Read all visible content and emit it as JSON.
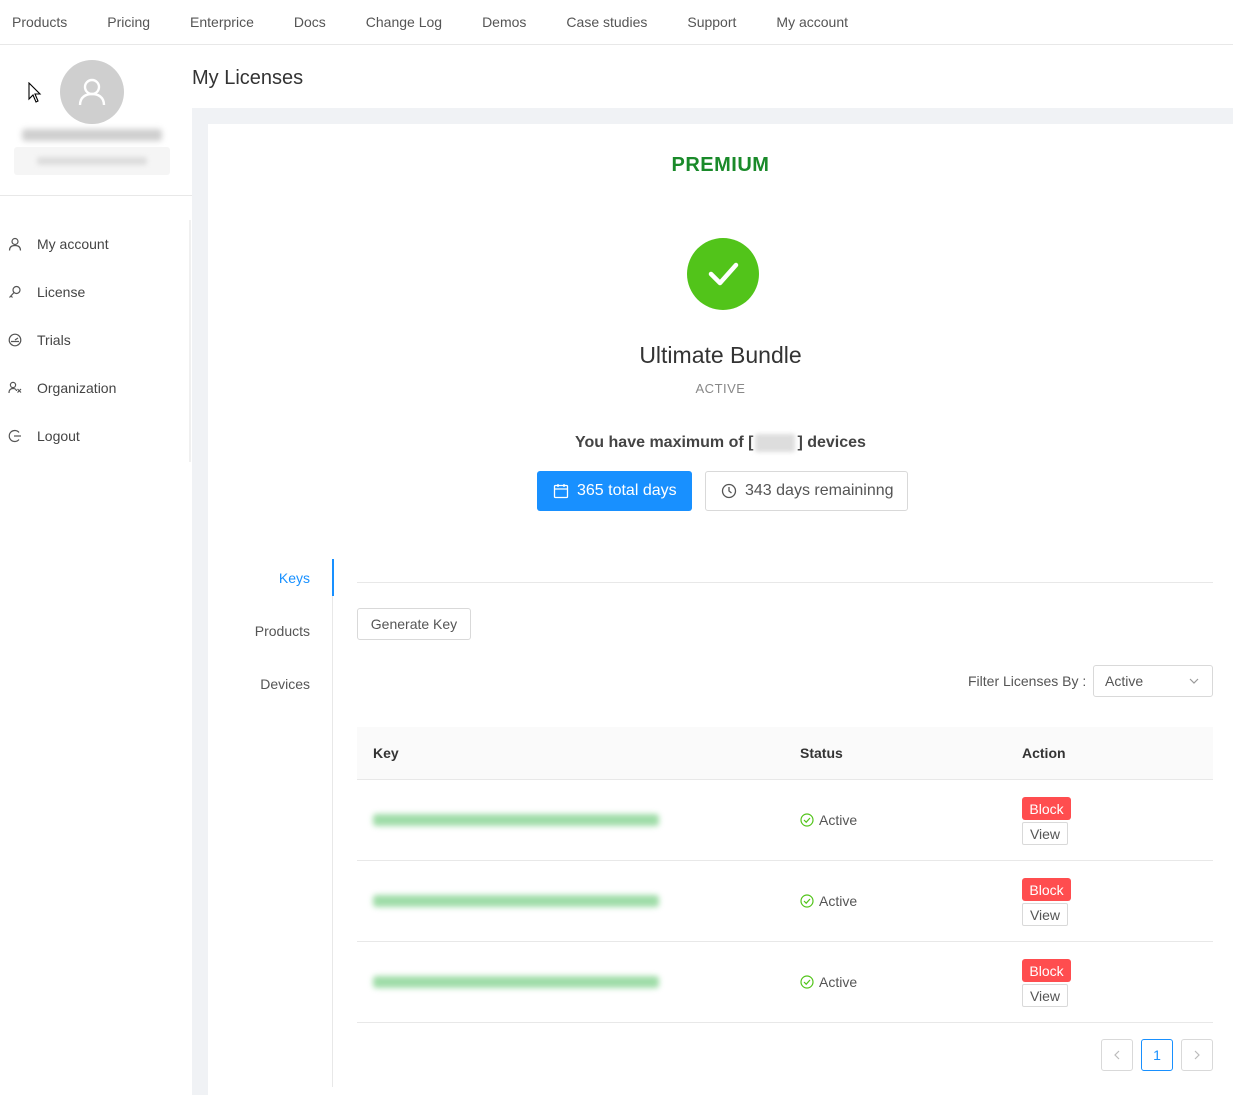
{
  "nav": {
    "items": [
      "Products",
      "Pricing",
      "Enterprice",
      "Docs",
      "Change Log",
      "Demos",
      "Case studies",
      "Support",
      "My account"
    ]
  },
  "sidebar": {
    "items": [
      {
        "label": "My account",
        "icon": "user-icon"
      },
      {
        "label": "License",
        "icon": "key-icon"
      },
      {
        "label": "Trials",
        "icon": "dashboard-icon"
      },
      {
        "label": "Organization",
        "icon": "team-icon"
      },
      {
        "label": "Logout",
        "icon": "logout-icon"
      }
    ]
  },
  "page": {
    "title": "My Licenses"
  },
  "license": {
    "tier": "PREMIUM",
    "product": "Ultimate Bundle",
    "status": "ACTIVE",
    "max_devices_prefix": "You have maximum of [",
    "max_devices_suffix": "] devices",
    "total_days": "365 total days",
    "remaining_days": "343 days remaininng"
  },
  "tabs": {
    "items": [
      "Keys",
      "Products",
      "Devices"
    ],
    "active": "Keys"
  },
  "keys": {
    "generate_label": "Generate Key",
    "filter_label": "Filter Licenses By :",
    "filter_value": "Active",
    "columns": {
      "key": "Key",
      "status": "Status",
      "action": "Action"
    },
    "rows": [
      {
        "status": "Active",
        "block": "Block",
        "view": "View"
      },
      {
        "status": "Active",
        "block": "Block",
        "view": "View"
      },
      {
        "status": "Active",
        "block": "Block",
        "view": "View"
      }
    ],
    "pagination": {
      "current": "1"
    }
  },
  "colors": {
    "accent": "#1890ff",
    "premium": "#1a8a2a",
    "success": "#52c41a",
    "danger": "#ff4d4f"
  }
}
